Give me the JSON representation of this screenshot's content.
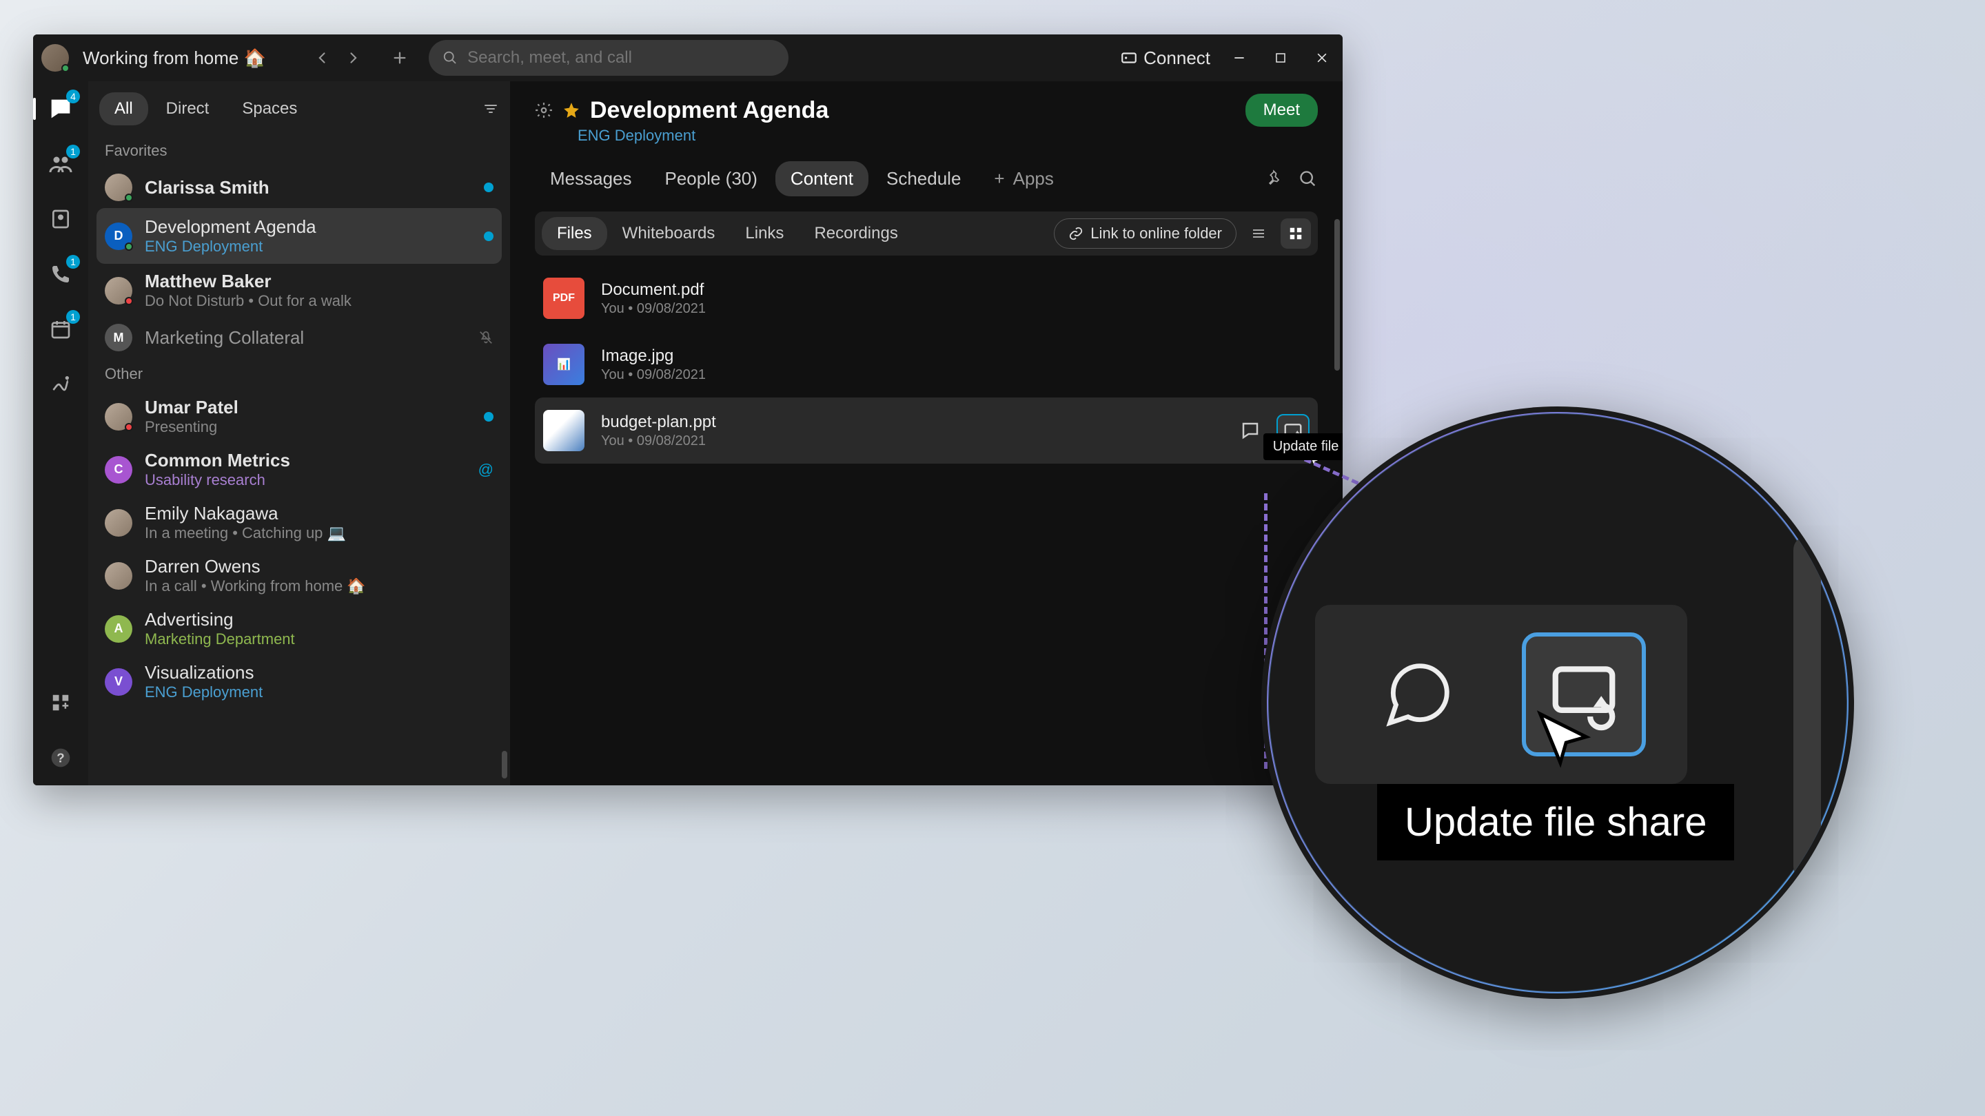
{
  "titlebar": {
    "status_label": "Working from home 🏠",
    "search_placeholder": "Search, meet, and call",
    "connect_label": "Connect"
  },
  "rail": {
    "chat_badge": "4",
    "contacts_badge": "1",
    "calls_badge": "1",
    "calendar_badge": "1"
  },
  "sidebar": {
    "tabs": {
      "all": "All",
      "direct": "Direct",
      "spaces": "Spaces"
    },
    "favorites_label": "Favorites",
    "other_label": "Other",
    "items": [
      {
        "name": "Clarissa Smith",
        "sub": ""
      },
      {
        "name": "Development Agenda",
        "sub": "ENG Deployment"
      },
      {
        "name": "Matthew Baker",
        "sub": "Do Not Disturb  •  Out for a walk"
      },
      {
        "name": "Marketing Collateral",
        "sub": ""
      },
      {
        "name": "Umar Patel",
        "sub": "Presenting"
      },
      {
        "name": "Common Metrics",
        "sub": "Usability research"
      },
      {
        "name": "Emily Nakagawa",
        "sub": "In a meeting  •  Catching up 💻"
      },
      {
        "name": "Darren Owens",
        "sub": "In a call  •  Working from home 🏠"
      },
      {
        "name": "Advertising",
        "sub": "Marketing Department"
      },
      {
        "name": "Visualizations",
        "sub": "ENG Deployment"
      }
    ]
  },
  "main": {
    "title": "Development Agenda",
    "sub": "ENG Deployment",
    "meet_label": "Meet",
    "tabs": {
      "messages": "Messages",
      "people": "People (30)",
      "content": "Content",
      "schedule": "Schedule",
      "apps": "Apps"
    },
    "content_bar": {
      "files": "Files",
      "whiteboards": "Whiteboards",
      "links": "Links",
      "recordings": "Recordings",
      "link_folder": "Link to online folder"
    },
    "files": [
      {
        "name": "Document.pdf",
        "meta": "You   •   09/08/2021"
      },
      {
        "name": "Image.jpg",
        "meta": "You   •   09/08/2021"
      },
      {
        "name": "budget-plan.ppt",
        "meta": "You   •   09/08/2021"
      }
    ],
    "tooltip": "Update file share"
  },
  "zoom": {
    "tooltip": "Update file share"
  }
}
